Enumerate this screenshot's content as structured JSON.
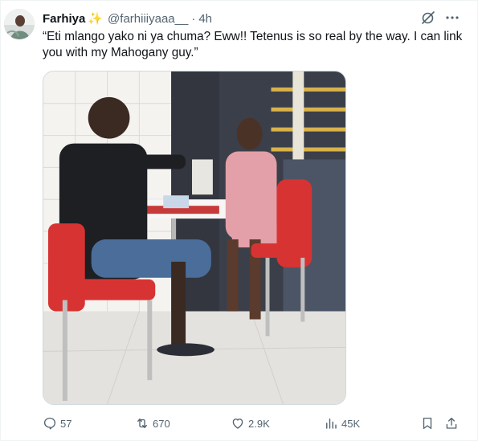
{
  "author": {
    "display_name": "Farhiya",
    "badge_icon": "sparkle-icon",
    "handle": "@farhiiiyaaa__",
    "separator": "·",
    "time": "4h"
  },
  "tweet": {
    "text": "“Eti mlango yako ni ya chuma? Eww!! Tetenus is so real by the way. I can link you with my Mahogany guy.”"
  },
  "actions": {
    "replies": "57",
    "retweets": "670",
    "likes": "2.9K",
    "views": "45K"
  },
  "colors": {
    "text_primary": "#0f1419",
    "text_secondary": "#536471",
    "badge": "#f5b30a",
    "border": "#cfd9de"
  }
}
